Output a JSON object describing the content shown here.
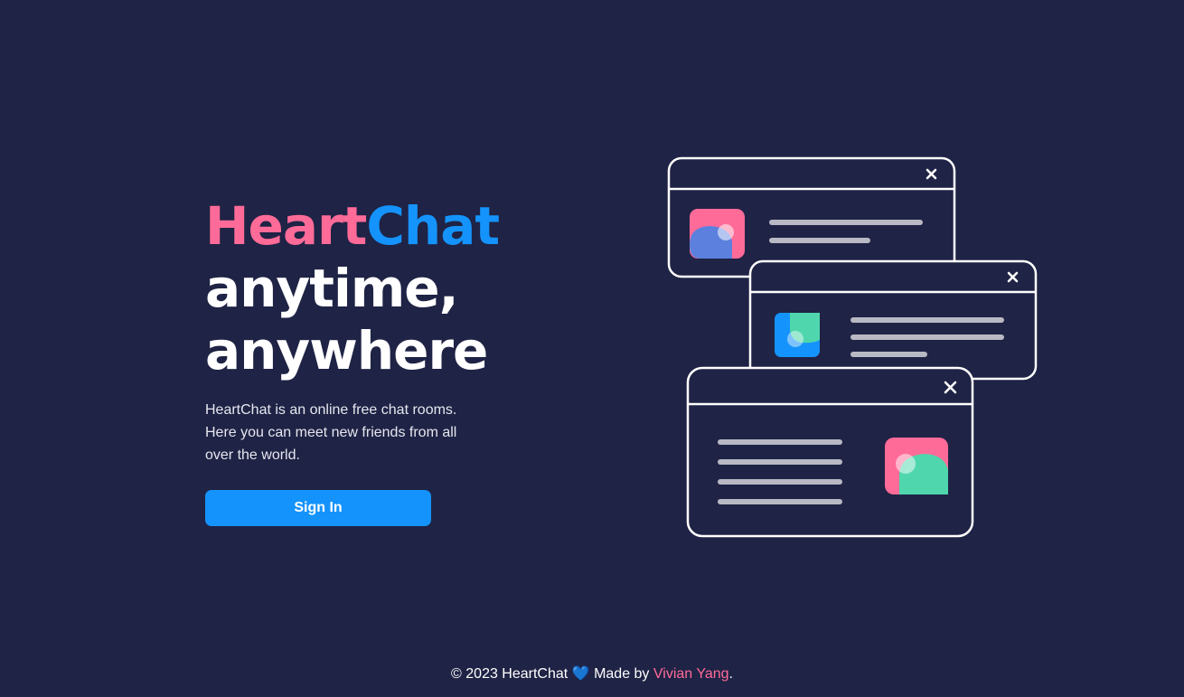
{
  "hero": {
    "brand_part1": "Heart",
    "brand_part2": "Chat",
    "headline_line2": "anytime,",
    "headline_line3": "anywhere",
    "description": "HeartChat is an online free chat rooms. Here you can meet new friends from all over the world.",
    "signin_label": "Sign In"
  },
  "illustration": {
    "close_glyph": "✕",
    "windows": [
      "chat-window-top",
      "chat-window-middle",
      "chat-window-bottom"
    ]
  },
  "footer": {
    "prefix": "© 2023 HeartChat",
    "heart": "💙",
    "made_by": "Made by",
    "author": "Vivian Yang",
    "suffix": "."
  },
  "colors": {
    "background": "#1f2345",
    "brand_pink": "#ff6b98",
    "brand_blue": "#1593fc",
    "avatar_green": "#4fd6ad",
    "avatar_periwinkle": "#5b80de",
    "text_line_gray": "#b8b9c4"
  }
}
